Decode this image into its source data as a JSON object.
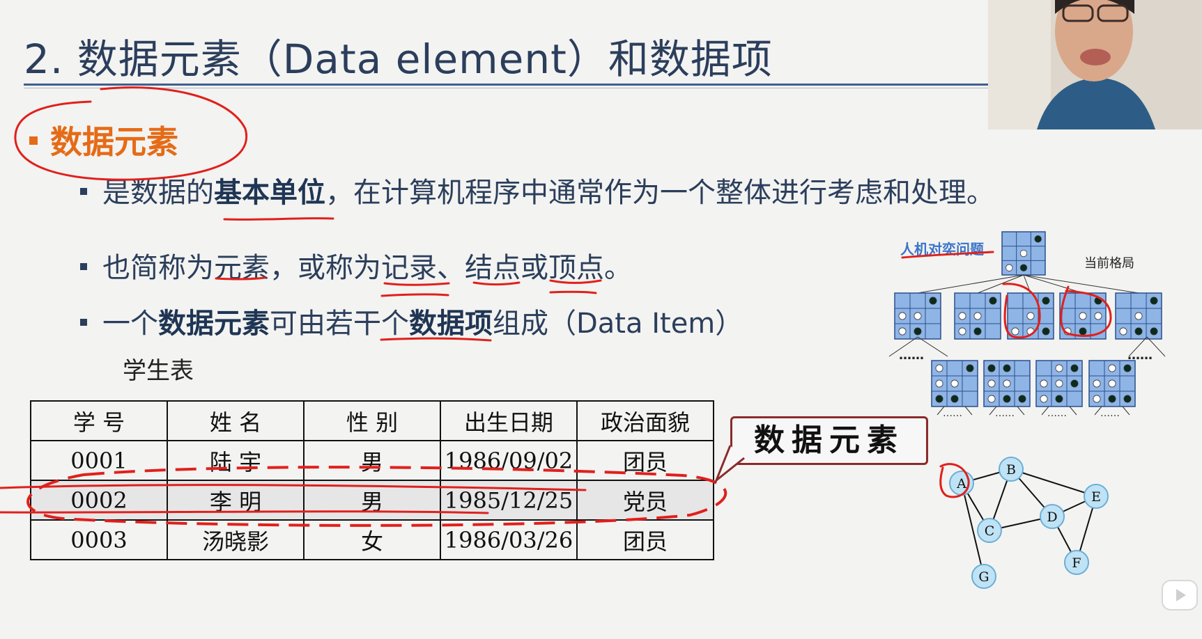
{
  "title": "2. 数据元素（Data element）和数据项",
  "section": {
    "heading": "数据元素"
  },
  "bullets": [
    {
      "pre": "是数据的",
      "bold": "基本单位",
      "post": "，在计算机程序中通常作为一个整体进行考虑和处理。"
    },
    {
      "text": "也简称为元素，或称为记录、结点或顶点。"
    },
    {
      "pre": "一个",
      "bold1": "数据元素",
      "mid": "可由若干个",
      "bold2": "数据项",
      "post": "组成（Data Item）"
    }
  ],
  "table": {
    "caption": "学生表",
    "headers": [
      "学 号",
      "姓 名",
      "性 别",
      "出生日期",
      "政治面貌"
    ],
    "rows": [
      [
        "0001",
        "陆 宇",
        "男",
        "1986/09/02",
        "团员"
      ],
      [
        "0002",
        "李 明",
        "男",
        "1985/12/25",
        "党员"
      ],
      [
        "0003",
        "汤晓影",
        "女",
        "1986/03/26",
        "团员"
      ]
    ]
  },
  "callout": "数据元素",
  "tree": {
    "label": "人机对奕问题",
    "label2": "当前格局",
    "ellipsis": "……"
  },
  "graph": {
    "nodes": [
      "A",
      "B",
      "C",
      "D",
      "E",
      "F",
      "G"
    ]
  },
  "colors": {
    "title": "#2b3e5c",
    "heading": "#e56b17",
    "annotation": "#e0201c",
    "node_fill": "#bfe3f5",
    "board_fill": "#8fb4e6"
  }
}
